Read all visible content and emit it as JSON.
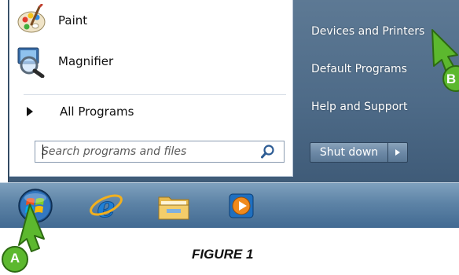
{
  "start_menu": {
    "programs": [
      {
        "label": "Paint",
        "icon": "paint-palette-icon"
      },
      {
        "label": "Magnifier",
        "icon": "magnifier-icon"
      }
    ],
    "all_programs_label": "All Programs",
    "search": {
      "placeholder": "Search programs and files",
      "value": ""
    },
    "right_pane": [
      {
        "label": "Devices and Printers"
      },
      {
        "label": "Default Programs"
      },
      {
        "label": "Help and Support"
      }
    ],
    "shutdown_label": "Shut down"
  },
  "taskbar": {
    "buttons": [
      {
        "icon": "windows-start-orb-icon"
      },
      {
        "icon": "internet-explorer-icon"
      },
      {
        "icon": "windows-explorer-folder-icon"
      },
      {
        "icon": "media-player-icon"
      }
    ]
  },
  "callouts": {
    "a": "A",
    "b": "B"
  },
  "caption": "FIGURE 1",
  "colors": {
    "menu_blue": "#4e6b88",
    "taskbar_blue": "#5d83a6",
    "callout_green": "#5cb82e"
  }
}
